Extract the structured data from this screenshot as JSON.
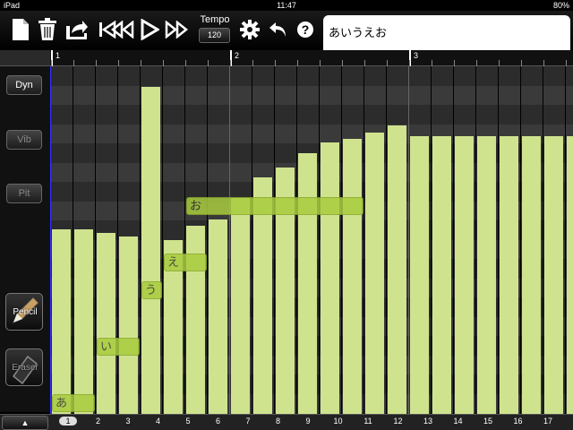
{
  "status": {
    "device": "iPad",
    "time": "11:47",
    "battery": "80%"
  },
  "toolbar": {
    "tempo_label": "Tempo",
    "tempo_value": "120"
  },
  "lyrics": {
    "text": "あいうえお"
  },
  "side": {
    "dyn": "Dyn",
    "vib": "Vib",
    "pit": "Pit",
    "pencil": "Pencil",
    "eraser": "Eraser"
  },
  "bottom": {
    "up": "▲",
    "numbers": [
      "1",
      "2",
      "3",
      "4",
      "5",
      "6",
      "7",
      "8",
      "9",
      "10",
      "11",
      "12",
      "13",
      "14",
      "15",
      "16",
      "17"
    ],
    "selected": "1"
  },
  "measures": [
    "1",
    "2",
    "3"
  ],
  "notes": [
    {
      "lyric": "あ",
      "start": 1,
      "length": 2,
      "pitch_row": 0
    },
    {
      "lyric": "い",
      "start": 3,
      "length": 2,
      "pitch_row": 2
    },
    {
      "lyric": "う",
      "start": 5,
      "length": 1,
      "pitch_row": 4
    },
    {
      "lyric": "え",
      "start": 6,
      "length": 2,
      "pitch_row": 5
    },
    {
      "lyric": "お",
      "start": 7,
      "length": 8,
      "pitch_row": 7
    }
  ],
  "dynamics": [
    0.53,
    0.53,
    0.52,
    0.51,
    0.94,
    0.5,
    0.54,
    0.56,
    0.62,
    0.68,
    0.71,
    0.75,
    0.78,
    0.79,
    0.81,
    0.83,
    0.8,
    0.8,
    0.8,
    0.8,
    0.8,
    0.8,
    0.8,
    0.8
  ]
}
